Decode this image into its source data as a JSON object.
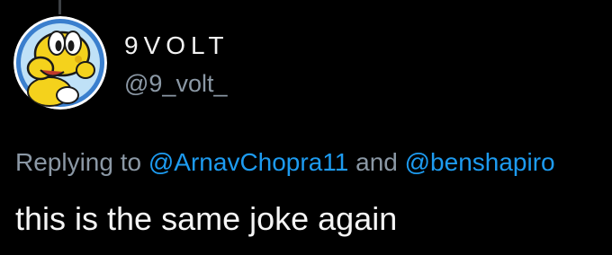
{
  "tweet": {
    "display_name": "9VOLT",
    "handle": "@9_volt_",
    "reply_prefix": "Replying to",
    "reply_mentions": [
      "@ArnavChopra11",
      "@benshapiro"
    ],
    "reply_joiner": "and",
    "text": "this is the same joke again"
  },
  "avatar": {
    "icon": "koopa-troopa-avatar-icon"
  },
  "colors": {
    "background": "#000000",
    "text": "#ffffff",
    "secondary_text": "#8b98a5",
    "mention": "#1d9bf0",
    "avatar_ring": "#2d6fb8",
    "avatar_character": "#f4d21c"
  }
}
